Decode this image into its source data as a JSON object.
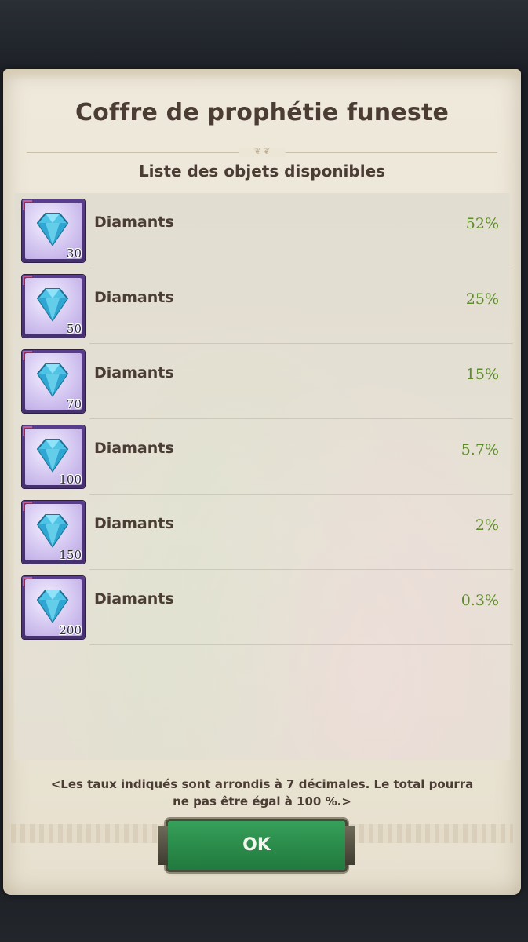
{
  "dialog": {
    "title": "Coffre de prophétie funeste",
    "list_header": "Liste des objets disponibles",
    "items": [
      {
        "name": "Diamants",
        "quantity": "30",
        "rate": "52%"
      },
      {
        "name": "Diamants",
        "quantity": "50",
        "rate": "25%"
      },
      {
        "name": "Diamants",
        "quantity": "70",
        "rate": "15%"
      },
      {
        "name": "Diamants",
        "quantity": "100",
        "rate": "5.7%"
      },
      {
        "name": "Diamants",
        "quantity": "150",
        "rate": "2%"
      },
      {
        "name": "Diamants",
        "quantity": "200",
        "rate": "0.3%"
      }
    ],
    "note_line1": "<Les taux indiqués sont arrondis à 7 décimales. Le total pourra",
    "note_line2": "ne pas être égal à 100 %.>",
    "ok_label": "OK"
  },
  "icons": {
    "item_icon": "diamond-icon"
  },
  "colors": {
    "rate_text": "#5e8c2a",
    "ok_button": "#2a8a49",
    "item_frame": "#46306e"
  }
}
